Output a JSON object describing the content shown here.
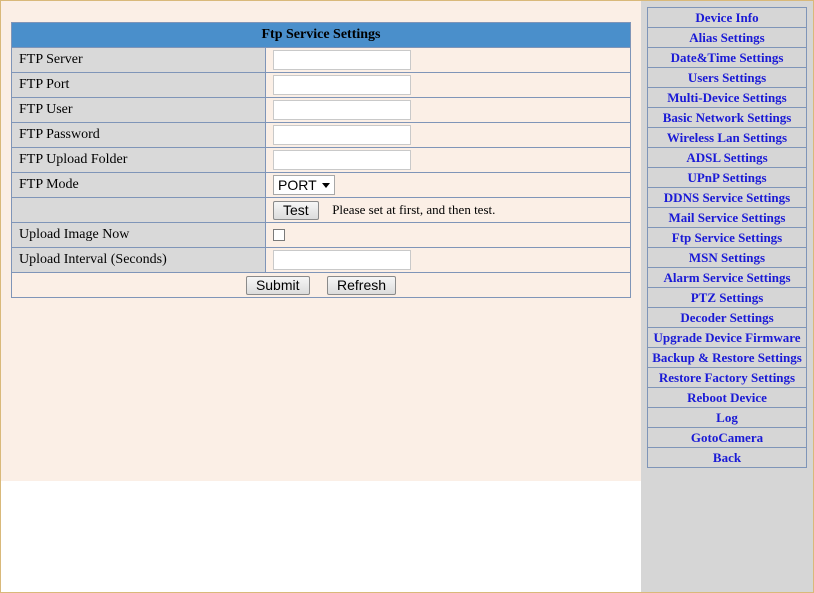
{
  "panel": {
    "title": "Ftp Service Settings",
    "fields": {
      "server_label": "FTP Server",
      "server_value": "",
      "port_label": "FTP Port",
      "port_value": "",
      "user_label": "FTP User",
      "user_value": "",
      "password_label": "FTP Password",
      "password_value": "",
      "folder_label": "FTP Upload Folder",
      "folder_value": "",
      "mode_label": "FTP Mode",
      "mode_value": "PORT",
      "test_button": "Test",
      "test_note": "Please set at first, and then test.",
      "upload_now_label": "Upload Image Now",
      "upload_now_checked": false,
      "interval_label": "Upload Interval (Seconds)",
      "interval_value": ""
    },
    "submit_button": "Submit",
    "refresh_button": "Refresh"
  },
  "menu": {
    "items": [
      "Device Info",
      "Alias Settings",
      "Date&Time Settings",
      "Users Settings",
      "Multi-Device Settings",
      "Basic Network Settings",
      "Wireless Lan Settings",
      "ADSL Settings",
      "UPnP Settings",
      "DDNS Service Settings",
      "Mail Service Settings",
      "Ftp Service Settings",
      "MSN Settings",
      "Alarm Service Settings",
      "PTZ Settings",
      "Decoder Settings",
      "Upgrade Device Firmware",
      "Backup & Restore Settings",
      "Restore Factory Settings",
      "Reboot Device",
      "Log",
      "GotoCamera",
      "Back"
    ]
  },
  "colors": {
    "header_bg": "#4a8fcb",
    "label_bg": "#d9d9d9",
    "panel_bg": "#fbefe6",
    "sidebar_bg": "#d6d6d6",
    "link": "#1a1ad6"
  }
}
